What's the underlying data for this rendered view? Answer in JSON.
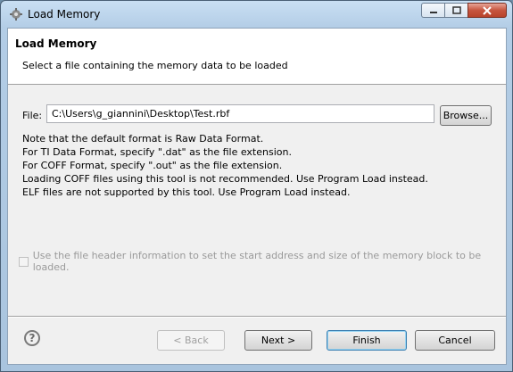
{
  "window": {
    "title": "Load Memory"
  },
  "header": {
    "title": "Load Memory",
    "description": "Select a file containing the memory data to be loaded"
  },
  "file": {
    "label": "File:",
    "value": "C:\\Users\\g_giannini\\Desktop\\Test.rbf",
    "browse_label": "Browse..."
  },
  "notes": [
    "Note that the default format is Raw Data Format.",
    "For TI Data Format, specify \".dat\" as the file extension.",
    "For COFF Format, specify \".out\" as the file extension.",
    "Loading COFF files using this tool is not recommended. Use Program Load instead.",
    "ELF files are not supported by this tool. Use Program Load instead."
  ],
  "option": {
    "label": "Use the file header information to set the start address and size of the memory block to be loaded.",
    "checked": false,
    "enabled": false
  },
  "buttons": {
    "back": "< Back",
    "next": "Next >",
    "finish": "Finish",
    "cancel": "Cancel"
  },
  "icons": {
    "app": "gear-icon",
    "help": "help-icon"
  }
}
